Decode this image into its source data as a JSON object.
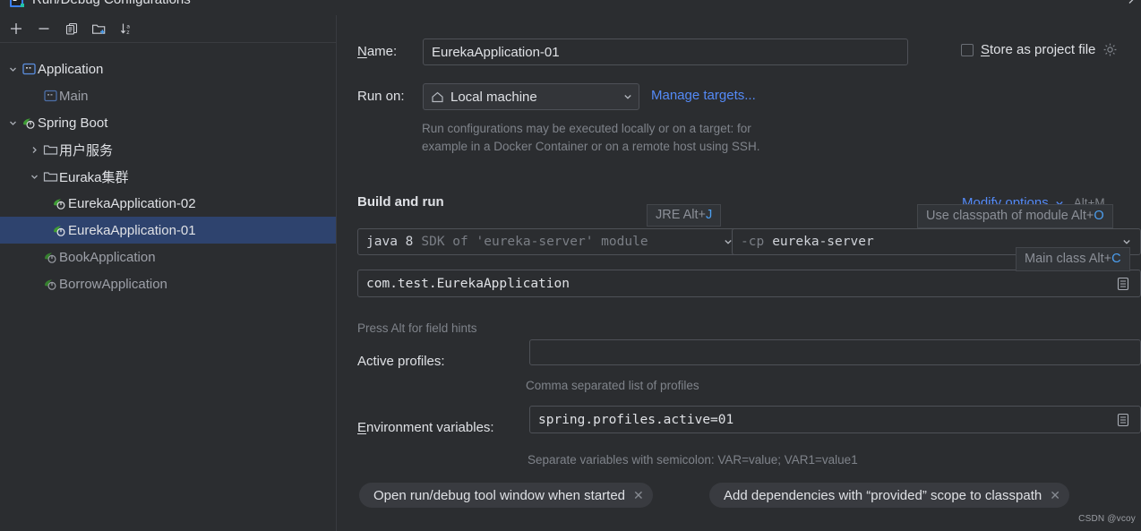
{
  "window": {
    "title": "Run/Debug Configurations",
    "app_icon": "intellij-idea-icon",
    "close_icon": "close-icon"
  },
  "toolbar": {
    "buttons": [
      {
        "name": "add-configuration-button",
        "icon": "plus-icon",
        "label": "+"
      },
      {
        "name": "remove-configuration-button",
        "icon": "minus-icon",
        "label": "−"
      },
      {
        "name": "copy-configuration-button",
        "icon": "copy-icon",
        "label": "Copy"
      },
      {
        "name": "new-folder-button",
        "icon": "new-folder-icon",
        "label": "New Folder"
      },
      {
        "name": "sort-configurations-button",
        "icon": "sort-alphabetical-icon",
        "label": "Sort"
      }
    ]
  },
  "tree": {
    "nodes": [
      {
        "label": "Application",
        "icon": "application-icon",
        "level": 0,
        "arrow": "expanded",
        "selected": false,
        "tone": "bright"
      },
      {
        "label": "Main",
        "icon": "application-icon",
        "level": 1,
        "arrow": "none",
        "selected": false,
        "tone": "dim"
      },
      {
        "label": "Spring Boot",
        "icon": "spring-boot-icon",
        "level": 0,
        "arrow": "expanded",
        "selected": false,
        "tone": "bright"
      },
      {
        "label": "用户服务",
        "icon": "folder-icon",
        "level": 1,
        "arrow": "collapsed",
        "selected": false,
        "tone": "bright"
      },
      {
        "label": "Euraka集群",
        "icon": "folder-icon",
        "level": 1,
        "arrow": "expanded",
        "selected": false,
        "tone": "bright"
      },
      {
        "label": "EurekaApplication-02",
        "icon": "spring-boot-icon",
        "level": 2,
        "arrow": "none",
        "selected": false,
        "tone": "bright"
      },
      {
        "label": "EurekaApplication-01",
        "icon": "spring-boot-icon",
        "level": 2,
        "arrow": "none",
        "selected": true,
        "tone": "bright"
      },
      {
        "label": "BookApplication",
        "icon": "spring-boot-icon",
        "level": 1,
        "arrow": "none",
        "selected": false,
        "tone": "dim"
      },
      {
        "label": "BorrowApplication",
        "icon": "spring-boot-icon",
        "level": 1,
        "arrow": "none",
        "selected": false,
        "tone": "dim"
      }
    ]
  },
  "form": {
    "name_label_pre": "N",
    "name_label_post": "ame:",
    "name_value": "EurekaApplication-01",
    "store_as_project_file": {
      "label_pre": "S",
      "label_post": "tore as project file",
      "checked": false,
      "gear_icon": "gear-icon"
    },
    "run_on_label": "Run on:",
    "run_on_value": "Local machine",
    "run_on_icon": "home-icon",
    "manage_targets_link": "Manage targets...",
    "run_on_description_line1": "Run configurations may be executed locally or on a target: for",
    "run_on_description_line2": "example in a Docker Container or on a remote host using SSH."
  },
  "build_and_run": {
    "section_title": "Build and run",
    "modify_options_link": "Modify options",
    "modify_options_shortcut": "Alt+M",
    "jre": {
      "value": "java 8",
      "secondary": "SDK of 'eureka-server' module"
    },
    "classpath": {
      "prefix": "-cp",
      "value": "eureka-server"
    },
    "main_class": "com.test.EurekaApplication",
    "field_hints_text": "Press Alt for field hints",
    "tooltips": [
      {
        "name": "jre-tooltip",
        "text": "JRE Alt+",
        "key": "J"
      },
      {
        "name": "classpath-module-tooltip",
        "text": "Use classpath of module Alt+",
        "key": "O"
      },
      {
        "name": "main-class-tooltip",
        "text": "Main class Alt+",
        "key": "C"
      }
    ]
  },
  "spring": {
    "active_profiles_label": "Active profiles:",
    "active_profiles_value": "",
    "active_profiles_hint": "Comma separated list of profiles",
    "env_label_pre": "E",
    "env_label_post": "nvironment variables:",
    "env_value": "spring.profiles.active=01",
    "env_hint": "Separate variables with semicolon: VAR=value; VAR1=value1",
    "browse_icon": "list-browse-icon"
  },
  "chips": [
    {
      "label": "Open run/debug tool window when started",
      "close_icon": "close-icon"
    },
    {
      "label": "Add dependencies with “provided” scope to classpath",
      "close_icon": "close-icon"
    }
  ],
  "watermark": "CSDN @vcoy",
  "colors": {
    "background": "#2b2d30",
    "selection": "#2e436e",
    "link": "#548af7",
    "accent_key": "#4c9ff0",
    "spring_green": "#3f9b35"
  }
}
